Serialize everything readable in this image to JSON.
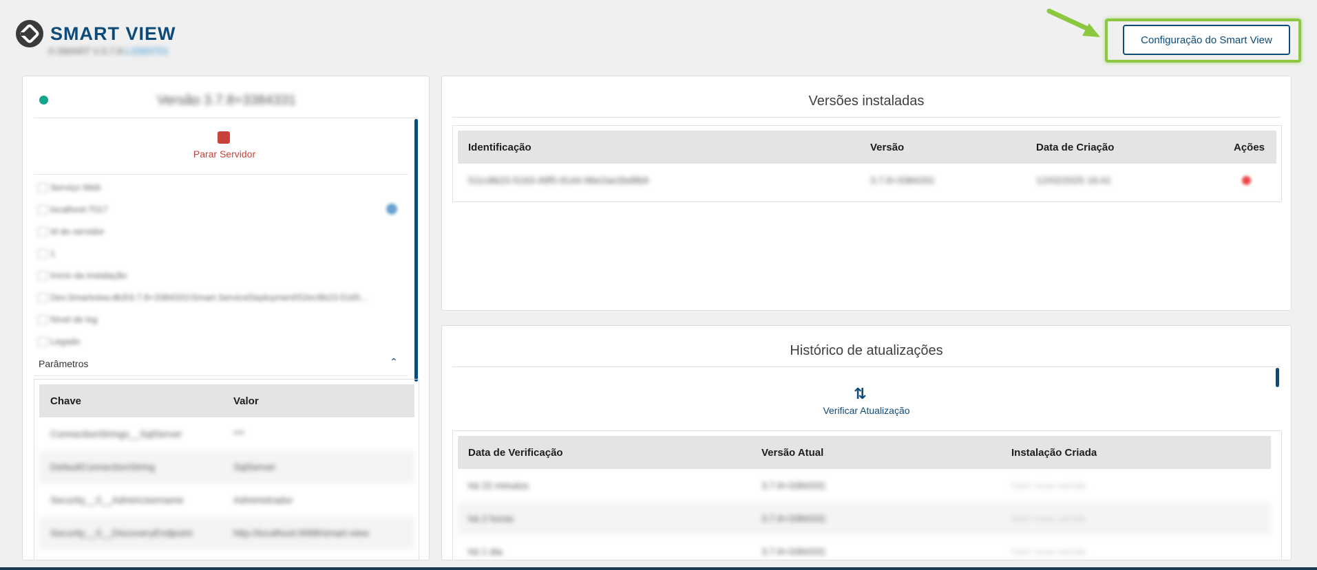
{
  "header": {
    "brand": "SMART VIEW",
    "subtitle_prefix": "A SMART V.3.7.8-",
    "subtitle_link": "L3383701"
  },
  "config_button": {
    "label": "Configuração do Smart View"
  },
  "left_panel": {
    "version_title": "Versão 3.7.8+3384331",
    "stop_label": "Parar Servidor",
    "info_lines": [
      "Serviço Web",
      "localhost:7017",
      "Id do servidor",
      "1",
      "Início da instalação",
      "Dev.Smartview.db3\\3.7.8+3384331\\Smart.ServiceDeployment\\52ec8b23-5165...",
      "Nível de log",
      "Legado"
    ],
    "params_label": "Parâmetros",
    "params_table": {
      "headers": [
        "Chave",
        "Valor"
      ],
      "rows": [
        [
          "ConnectionStrings__SqlServer",
          "***"
        ],
        [
          "DefaultConnectionString",
          "SqlServer"
        ],
        [
          "Security__0__AdminUsername",
          "Administrador"
        ],
        [
          "Security__0__DiscoveryEndpoint",
          "http://localhost:9998/smart-view"
        ]
      ]
    }
  },
  "installed": {
    "title": "Versões instaladas",
    "headers": [
      "Identificação",
      "Versão",
      "Data de Criação",
      "Ações"
    ],
    "rows": [
      [
        "511c8b23-5163-49f5-9144-96e2ae2bd9b9",
        "3.7.8+3384331",
        "12/02/2025 16:41"
      ]
    ]
  },
  "history": {
    "title": "Histórico de atualizações",
    "check_label": "Verificar Atualização",
    "headers": [
      "Data de Verificação",
      "Versão Atual",
      "Instalação Criada"
    ],
    "rows": [
      [
        "há 22 minutos",
        "3.7.8+3384331",
        "Sem nova versão"
      ],
      [
        "há 2 horas",
        "3.7.8+3384331",
        "Sem nova versão"
      ],
      [
        "há 1 dia",
        "3.7.8+3384331",
        "Sem nova versão"
      ]
    ]
  },
  "colors": {
    "brand": "#0c4a7a",
    "highlight": "#8cc83f",
    "status_ok": "#0fa98a",
    "danger": "#c8413a"
  }
}
